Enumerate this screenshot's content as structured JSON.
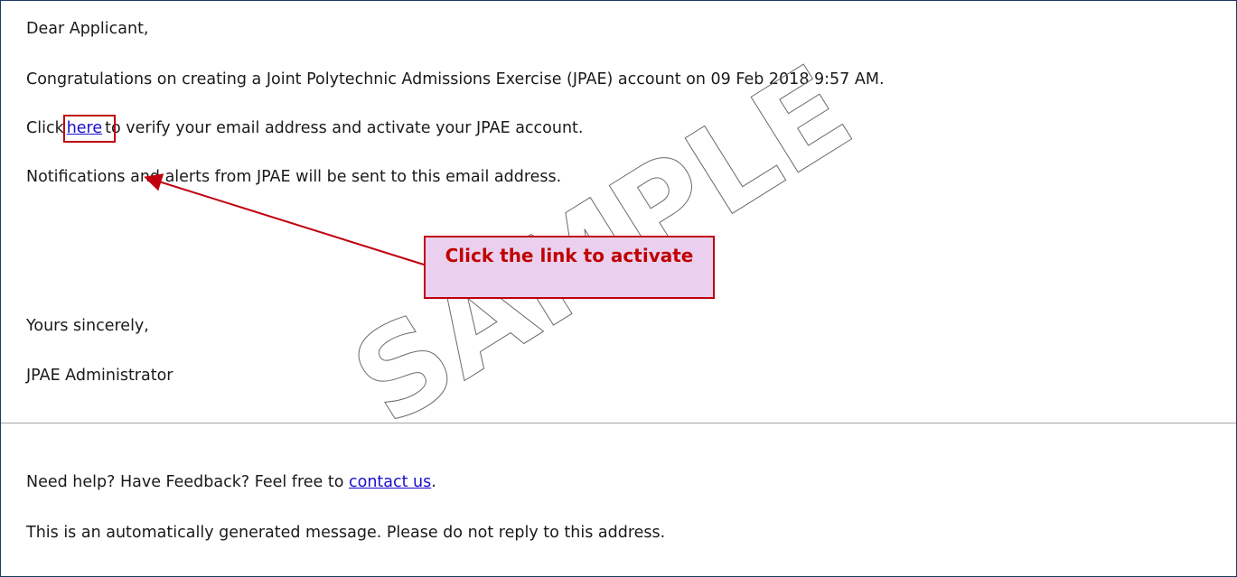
{
  "email": {
    "greeting": "Dear Applicant,",
    "congrats": "Congratulations on creating a Joint Polytechnic Admissions Exercise (JPAE) account on 09 Feb 2018 9:57 AM.",
    "click_prefix": "Click",
    "click_link": "here",
    "click_suffix": "to verify your email address and activate your JPAE account.",
    "notify": "Notifications and alerts from JPAE will be sent to this email address.",
    "sincerely": "Yours sincerely,",
    "signature": "JPAE Administrator",
    "help_prefix": "Need help? Have Feedback?  Feel free to ",
    "help_link": "contact us",
    "help_suffix": ".",
    "auto_notice": "This is an automatically generated message. Please do not reply to this address."
  },
  "annotation": {
    "callout_text": "Click the link to activate",
    "watermark": "SAMPLE",
    "accent_color": "#c0000f",
    "callout_bg": "#ead0ee"
  }
}
